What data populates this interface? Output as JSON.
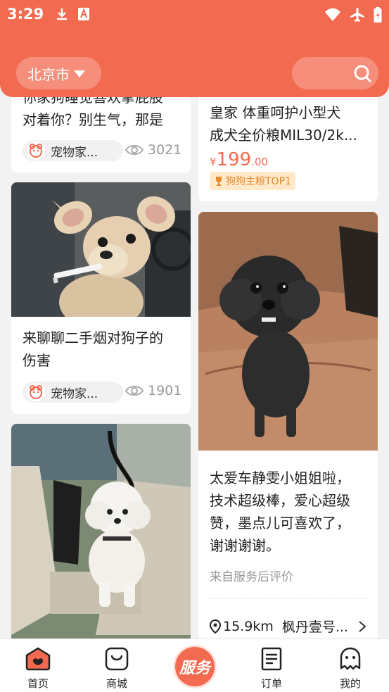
{
  "status_bar": {
    "time": "3:29"
  },
  "header": {
    "city": "北京市"
  },
  "feed": {
    "card1": {
      "title_lines": [
        "你家狗睡觉喜欢拿屁股",
        "对着你？别生气，那是"
      ],
      "author": "宠物家...",
      "views": "3021"
    },
    "card2": {
      "title_lines": [
        "来聊聊二手烟对狗子的",
        "伤害"
      ],
      "author": "宠物家...",
      "views": "1901"
    },
    "product": {
      "title_lines": [
        "皇家 体重呵护小型犬",
        "成犬全价粮MIL30/2k..."
      ],
      "price_symbol": "¥",
      "price_int": "199",
      "price_dec": ".00",
      "badge": "狗狗主粮TOP1"
    },
    "review": {
      "text_lines": [
        "太爱车静雯小姐姐啦，",
        "技术超级棒，爱心超级",
        "赞，墨点儿可喜欢了，",
        "谢谢谢谢。"
      ],
      "source": "来自服务后评价",
      "distance": "15.9km",
      "shop": "枫丹壹号..."
    }
  },
  "bottom_nav": {
    "home": "首页",
    "mall": "商城",
    "service": "服务",
    "orders": "订单",
    "mine": "我的"
  },
  "colors": {
    "accent": "#f26a4f",
    "badge_bg": "#ffe9c9",
    "badge_text": "#e4892d"
  }
}
